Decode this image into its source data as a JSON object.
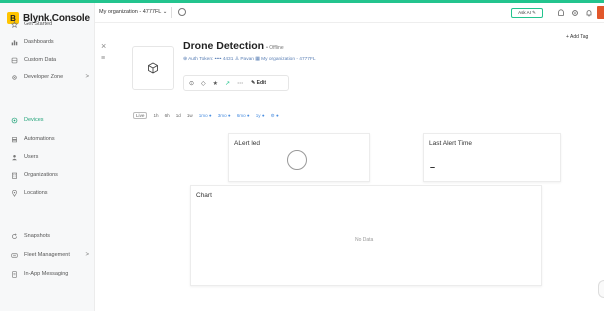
{
  "brand": {
    "logo_letter": "B",
    "name": "Blynk.Console"
  },
  "sidebar": {
    "items": [
      {
        "label": "Get Started",
        "icon": "star-icon"
      },
      {
        "label": "Dashboards",
        "icon": "dashboard-icon"
      },
      {
        "label": "Custom Data",
        "icon": "database-icon"
      },
      {
        "label": "Developer Zone",
        "icon": "gear-icon",
        "chevron": ">"
      },
      {
        "label": "Devices",
        "icon": "devices-icon",
        "active": true
      },
      {
        "label": "Automations",
        "icon": "automation-icon"
      },
      {
        "label": "Users",
        "icon": "users-icon"
      },
      {
        "label": "Organizations",
        "icon": "building-icon"
      },
      {
        "label": "Locations",
        "icon": "location-icon"
      },
      {
        "label": "Snapshots",
        "icon": "snapshot-icon"
      },
      {
        "label": "Fleet Management",
        "icon": "fleet-icon",
        "chevron": ">"
      },
      {
        "label": "In-App Messaging",
        "icon": "message-icon"
      }
    ]
  },
  "topbar": {
    "org_select": "My organization - 4777FL",
    "org_chevron": "⌄",
    "ask_ai": "Ask AI ✎"
  },
  "device": {
    "title": "Drone Detection",
    "status": "• Offline",
    "meta": "⊕ Auth Token: •••• 4431  ♙ Pavan  ▦ My organization - 4777FL",
    "edit_label": "✎ Edit",
    "add_tag": "+ Add Tag"
  },
  "time_range": [
    {
      "label": "Live",
      "selected": true
    },
    {
      "label": "1h"
    },
    {
      "label": "6h"
    },
    {
      "label": "1d"
    },
    {
      "label": "1w"
    },
    {
      "label": "1mo ●",
      "pro": true
    },
    {
      "label": "3mo ●",
      "pro": true
    },
    {
      "label": "6mo ●",
      "pro": true
    },
    {
      "label": "1y ●",
      "pro": true
    },
    {
      "label": "⚙ ●",
      "pro": true
    }
  ],
  "widgets": {
    "led": {
      "title": "ALert led"
    },
    "alert_time": {
      "title": "Last Alert Time",
      "value": "–"
    },
    "chart": {
      "title": "Chart",
      "empty_text": "No Data"
    }
  },
  "colors": {
    "accent": "#23c48e",
    "brand_yellow": "#ffc400",
    "user_badge": "#e2572b"
  }
}
